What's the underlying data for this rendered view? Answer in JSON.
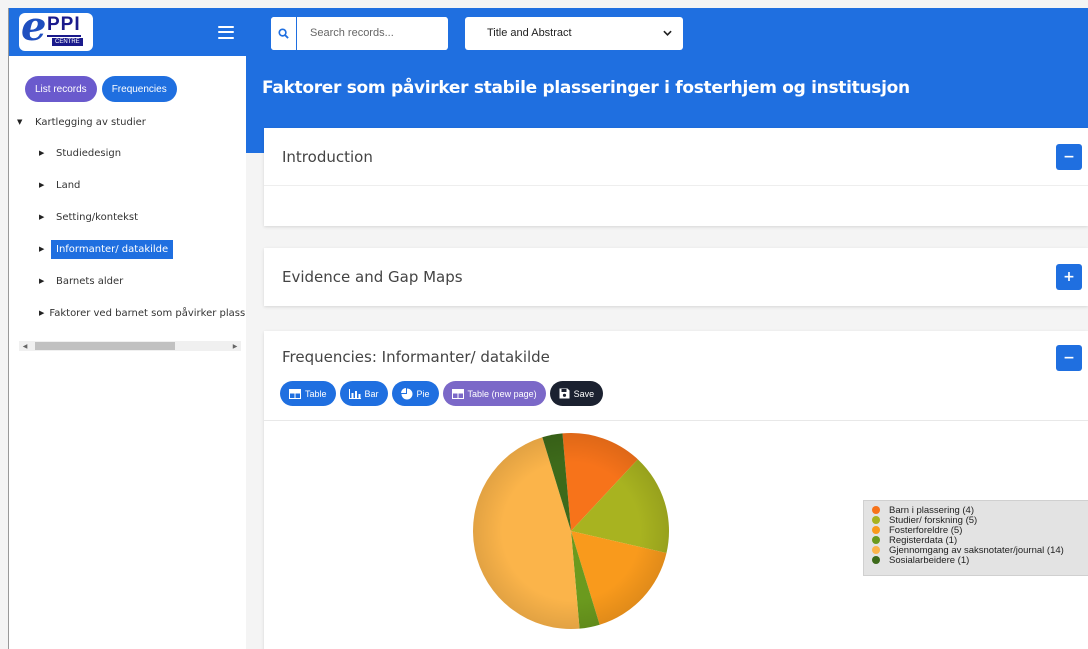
{
  "sidebar": {
    "logo": {
      "letter": "e",
      "ppi": "PPI",
      "centre": "CENTRE"
    },
    "buttons": {
      "list_records": "List records",
      "frequencies": "Frequencies"
    },
    "tree": {
      "root": "Kartlegging av studier",
      "items": [
        {
          "label": "Studiedesign",
          "active": false
        },
        {
          "label": "Land",
          "active": false
        },
        {
          "label": "Setting/kontekst",
          "active": false
        },
        {
          "label": "Informanter/ datakilde",
          "active": true
        },
        {
          "label": "Barnets alder",
          "active": false
        },
        {
          "label": "Faktorer ved barnet som påvirker plass",
          "active": false
        }
      ]
    }
  },
  "topbar": {
    "search": {
      "placeholder": "Search records..."
    },
    "select": {
      "value": "Title and Abstract"
    }
  },
  "main": {
    "title": "Faktorer som påvirker stabile plasseringer i fosterhjem og institusjon",
    "cards": {
      "introduction": {
        "title": "Introduction",
        "toggle": "−"
      },
      "evidence": {
        "title": "Evidence and Gap Maps",
        "toggle": "+"
      },
      "frequencies": {
        "title": "Frequencies: Informanter/ datakilde",
        "toggle": "−"
      }
    },
    "freq_buttons": {
      "table": "Table",
      "bar": "Bar",
      "pie": "Pie",
      "table_new": "Table (new page)",
      "save": "Save"
    }
  },
  "colors": {
    "brand_blue": "#1f6fe0",
    "purple": "#6a5acd",
    "dark": "#1b2130"
  },
  "chart_data": {
    "type": "pie",
    "title": "",
    "legend_position": "right",
    "slices": [
      {
        "label": "Barn i plassering (4)",
        "value": 4,
        "color": "#f7731a"
      },
      {
        "label": "Studier/ forskning (5)",
        "value": 5,
        "color": "#a8b320"
      },
      {
        "label": "Fosterforeldre (5)",
        "value": 5,
        "color": "#f99a1c"
      },
      {
        "label": "Registerdata (1)",
        "value": 1,
        "color": "#6b9a1e"
      },
      {
        "label": "Gjennomgang av saksnotater/journal (14)",
        "value": 14,
        "color": "#fbb44a"
      },
      {
        "label": "Sosialarbeidere (1)",
        "value": 1,
        "color": "#3d6a1a"
      }
    ]
  }
}
